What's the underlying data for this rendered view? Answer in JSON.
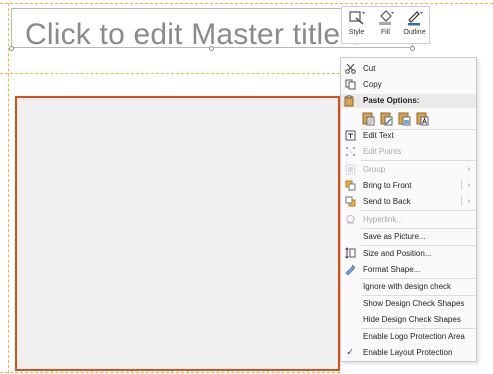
{
  "slide": {
    "title_placeholder": "Click to edit Master title s"
  },
  "mini_toolbar": {
    "buttons": [
      {
        "label": "Style",
        "icon": "shape-style-icon"
      },
      {
        "label": "Fill",
        "icon": "paint-bucket-icon"
      },
      {
        "label": "Outline",
        "icon": "pen-outline-icon"
      }
    ]
  },
  "menu": {
    "cut": "Cut",
    "copy": "Copy",
    "paste_options": "Paste Options:",
    "edit_text": "Edit Text",
    "edit_points": "Edit Points",
    "group": "Group",
    "bring_to_front": "Bring to Front",
    "send_to_back": "Send to Back",
    "hyperlink": "Hyperlink...",
    "save_as_picture": "Save as Picture...",
    "size_and_position": "Size and Position...",
    "format_shape": "Format Shape...",
    "ignore_design_check": "Ignore with design check",
    "show_design_check": "Show Design Check Shapes",
    "hide_design_check": "Hide Design Check Shapes",
    "enable_logo_protection": "Enable Logo Protection Area",
    "enable_layout_protection": "Enable Layout Protection",
    "checkmark": "✓"
  },
  "colors": {
    "shape_border": "#d94f15",
    "shape_fill": "#efefef",
    "guide_dash": "#f2b24b"
  }
}
